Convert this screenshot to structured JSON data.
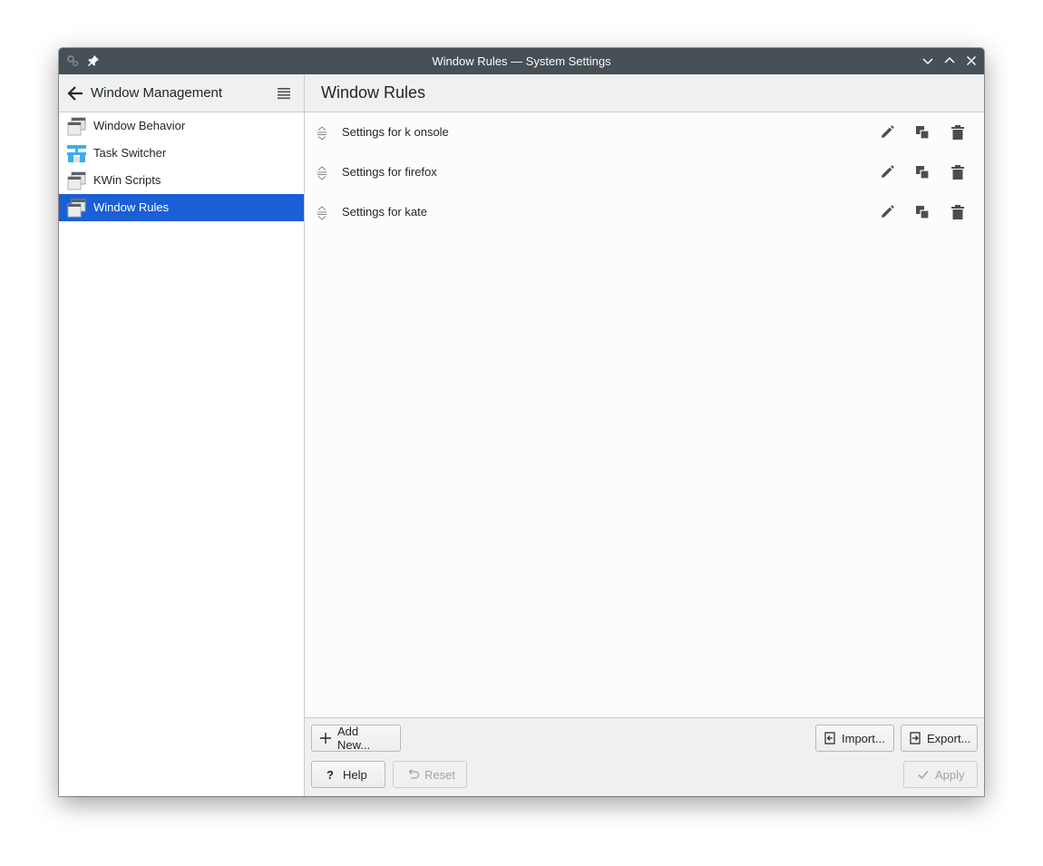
{
  "window": {
    "title": "Window Rules — System Settings"
  },
  "sidebar": {
    "header_title": "Window Management",
    "items": [
      {
        "label": "Window Behavior",
        "icon": "window-behavior-icon",
        "selected": false
      },
      {
        "label": "Task Switcher",
        "icon": "task-switcher-icon",
        "selected": false
      },
      {
        "label": "KWin Scripts",
        "icon": "kwin-scripts-icon",
        "selected": false
      },
      {
        "label": "Window Rules",
        "icon": "window-rules-icon",
        "selected": true
      }
    ]
  },
  "main": {
    "title": "Window Rules",
    "rules": [
      {
        "label": "Settings for k onsole"
      },
      {
        "label": "Settings for firefox"
      },
      {
        "label": "Settings for kate"
      }
    ]
  },
  "footer": {
    "add_new": "Add New...",
    "import": "Import...",
    "export": "Export...",
    "help": "Help",
    "reset": "Reset",
    "apply": "Apply"
  },
  "colors": {
    "titlebar": "#475057",
    "selection": "#1b5fd6",
    "window_bg": "#eff0f1",
    "content_bg": "#fcfcfc"
  }
}
